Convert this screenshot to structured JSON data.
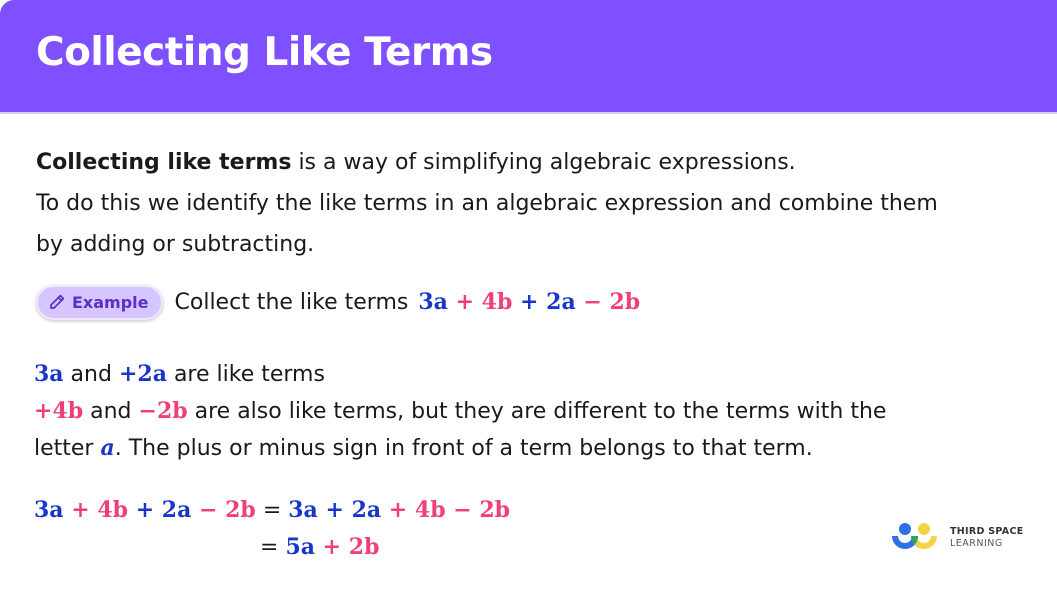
{
  "header": {
    "title": "Collecting Like Terms",
    "color": "#7f50ff"
  },
  "intro": {
    "bold_lead": "Collecting like terms",
    "line1_rest": " is a way of simplifying algebraic expressions.",
    "line2": "To do this we identify the like terms in an algebraic expression and combine them",
    "line3": "by adding or subtracting."
  },
  "example": {
    "badge_label": "Example",
    "badge_icon": "pencil-icon",
    "prompt": "Collect the like terms",
    "expression": [
      {
        "t": "3a",
        "c": "blue"
      },
      {
        "t": " + ",
        "c": "pink"
      },
      {
        "t": "4b",
        "c": "pink"
      },
      {
        "t": " + ",
        "c": "blue"
      },
      {
        "t": "2a",
        "c": "blue"
      },
      {
        "t": " − ",
        "c": "pink"
      },
      {
        "t": "2b",
        "c": "pink"
      }
    ]
  },
  "explanation": {
    "line1": {
      "term1": "3a",
      "and": " and ",
      "term2": "+2a",
      "rest": " are like terms"
    },
    "line2": {
      "term1": "+4b",
      "and": " and ",
      "term2": "−2b",
      "rest": " are also like terms, but they are different to the terms with the"
    },
    "line3": {
      "lead": "letter ",
      "term": "a",
      "rest": ".  The plus or minus sign in front of a term belongs to that term."
    }
  },
  "working": {
    "row1": [
      {
        "t": "3a",
        "c": "blue"
      },
      {
        "t": " + ",
        "c": "pink"
      },
      {
        "t": "4b",
        "c": "pink"
      },
      {
        "t": " + ",
        "c": "blue"
      },
      {
        "t": "2a",
        "c": "blue"
      },
      {
        "t": " − ",
        "c": "pink"
      },
      {
        "t": "2b",
        "c": "pink"
      },
      {
        "t": " = ",
        "c": "black"
      },
      {
        "t": "3a",
        "c": "blue"
      },
      {
        "t": " + ",
        "c": "blue"
      },
      {
        "t": "2a",
        "c": "blue"
      },
      {
        "t": " + ",
        "c": "pink"
      },
      {
        "t": "4b",
        "c": "pink"
      },
      {
        "t": " − ",
        "c": "pink"
      },
      {
        "t": "2b",
        "c": "pink"
      }
    ],
    "row2": [
      {
        "t": "= ",
        "c": "black"
      },
      {
        "t": "5a",
        "c": "blue"
      },
      {
        "t": " + ",
        "c": "pink"
      },
      {
        "t": "2b",
        "c": "pink"
      }
    ]
  },
  "logo": {
    "line1": "THIRD SPACE",
    "line2": "LEARNING"
  },
  "colors": {
    "blue": "#1a36c9",
    "pink": "#ef3f78",
    "purple": "#7f50ff"
  }
}
